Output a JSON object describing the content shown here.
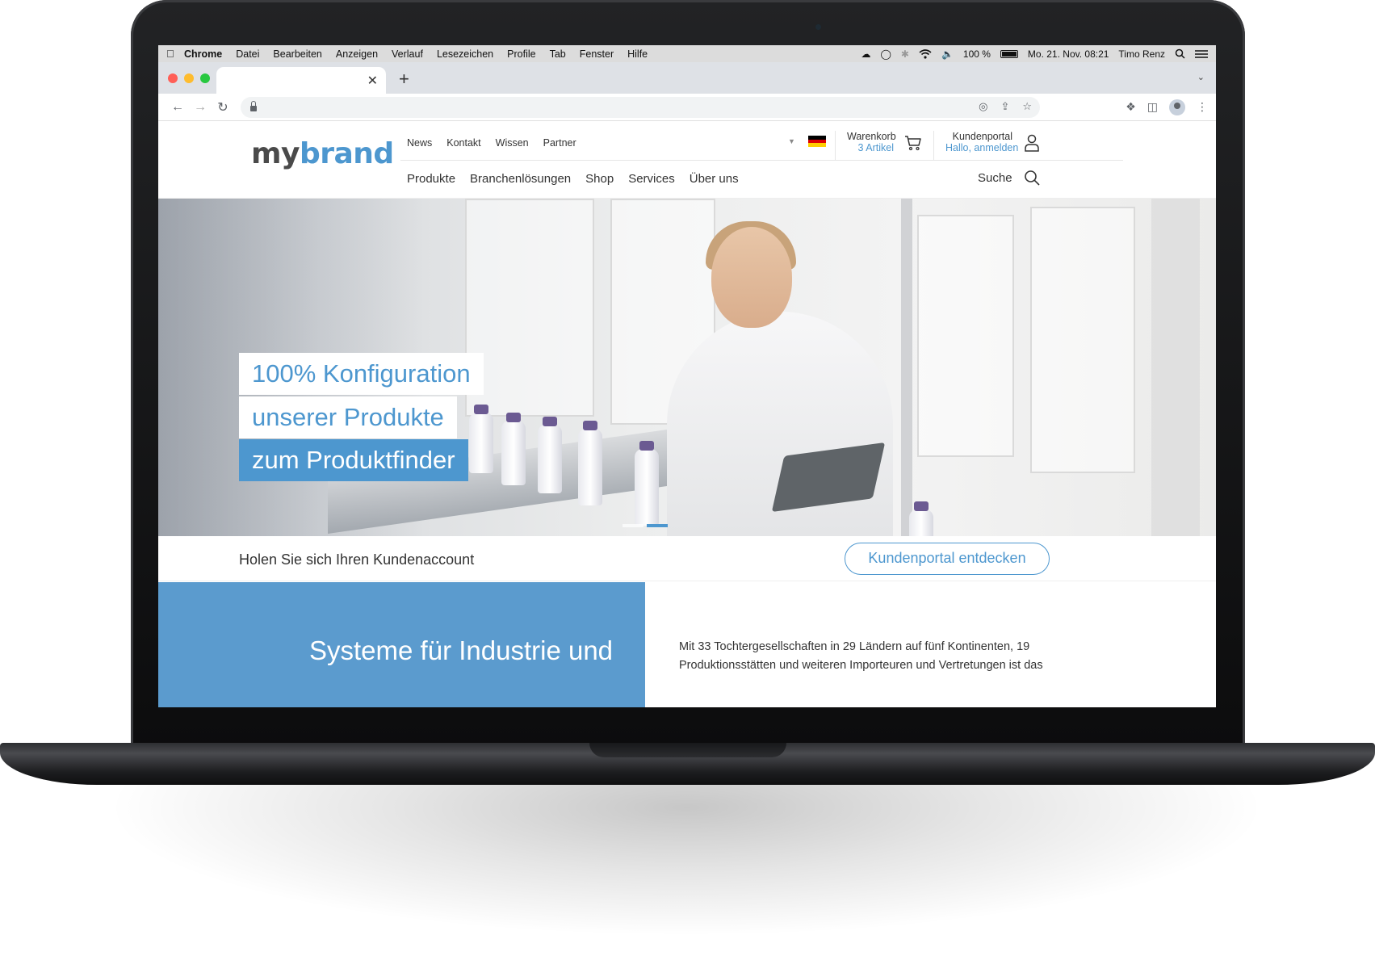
{
  "menubar": {
    "app": "Chrome",
    "items": [
      "Datei",
      "Bearbeiten",
      "Anzeigen",
      "Verlauf",
      "Lesezeichen",
      "Profile",
      "Tab",
      "Fenster",
      "Hilfe"
    ],
    "battery": "100 %",
    "datetime": "Mo. 21. Nov.  08:21",
    "user": "Timo Renz"
  },
  "browser": {
    "tab_title": "",
    "url": "",
    "traffic_colors": [
      "#ff5f57",
      "#febc2e",
      "#28c840"
    ]
  },
  "site": {
    "logo": {
      "my": "my",
      "brand": "brand"
    },
    "top_nav": [
      "News",
      "Kontakt",
      "Wissen",
      "Partner"
    ],
    "main_nav": [
      "Produkte",
      "Branchenlösungen",
      "Shop",
      "Services",
      "Über uns"
    ],
    "cart": {
      "label": "Warenkorb",
      "count": "3 Artikel"
    },
    "portal": {
      "label": "Kundenportal",
      "login": "Hallo, anmelden"
    },
    "search_label": "Suche",
    "hero": {
      "line1": "100% Konfiguration",
      "line2": "unserer Produkte",
      "cta": "zum Produktfinder",
      "slides": 2,
      "active_slide": 1
    },
    "account": {
      "text": "Holen Sie sich Ihren Kundenaccount",
      "button": "Kundenportal entdecken"
    },
    "section": {
      "heading": "Systeme für Industrie und",
      "intro": "Mit 33 Tochtergesellschaften in 29 Ländern auf fünf Kontinenten, 19 Produktionsstätten und weiteren Importeuren und Vertretungen ist das"
    },
    "colors": {
      "accent": "#4d97cf",
      "panel": "#5b9bce",
      "text": "#333333"
    }
  }
}
